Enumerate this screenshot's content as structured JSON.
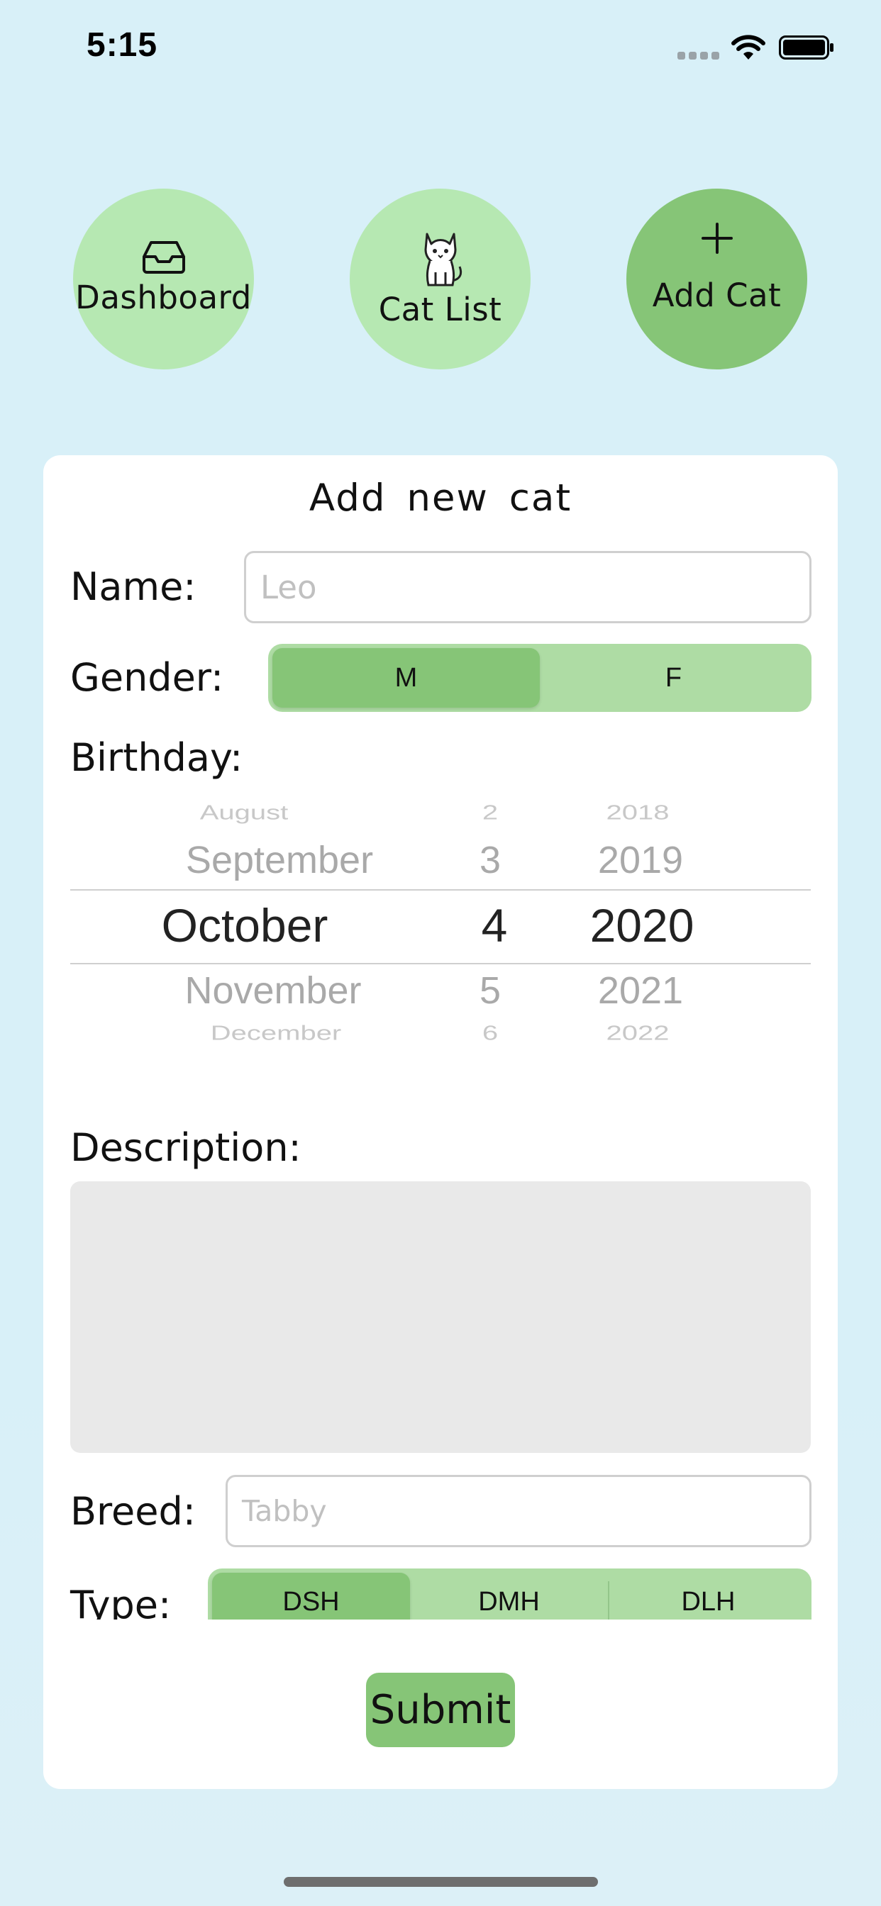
{
  "status_bar": {
    "time": "5:15"
  },
  "nav": {
    "dashboard_label": "Dashboard",
    "catlist_label": "Cat List",
    "addcat_label": "Add  Cat"
  },
  "form": {
    "title": "Add  new  cat",
    "name_label": "Name:",
    "name_placeholder": "Leo",
    "gender_label": "Gender:",
    "gender_options": [
      "M",
      "F"
    ],
    "gender_selected": "M",
    "birthday_label": "Birthday:",
    "birthday_picker": {
      "months": [
        "August",
        "September",
        "October",
        "November",
        "December"
      ],
      "days": [
        "2",
        "3",
        "4",
        "5",
        "6"
      ],
      "years": [
        "2018",
        "2019",
        "2020",
        "2021",
        "2022"
      ],
      "selected": {
        "month": "October",
        "day": "4",
        "year": "2020"
      }
    },
    "description_label": "Description:",
    "description_value": "",
    "breed_label": "Breed:",
    "breed_placeholder": "Tabby",
    "type_label": "Type:",
    "type_options": [
      "DSH",
      "DMH",
      "DLH"
    ],
    "type_selected": "DSH",
    "submit_label": "Submit"
  },
  "colors": {
    "background": "#d8f0f8",
    "nav_inactive": "#b6e8b2",
    "nav_active": "#86c577",
    "segment_track": "#aedca4",
    "segment_selected": "#86c577",
    "description_bg": "#e9e9e9"
  }
}
